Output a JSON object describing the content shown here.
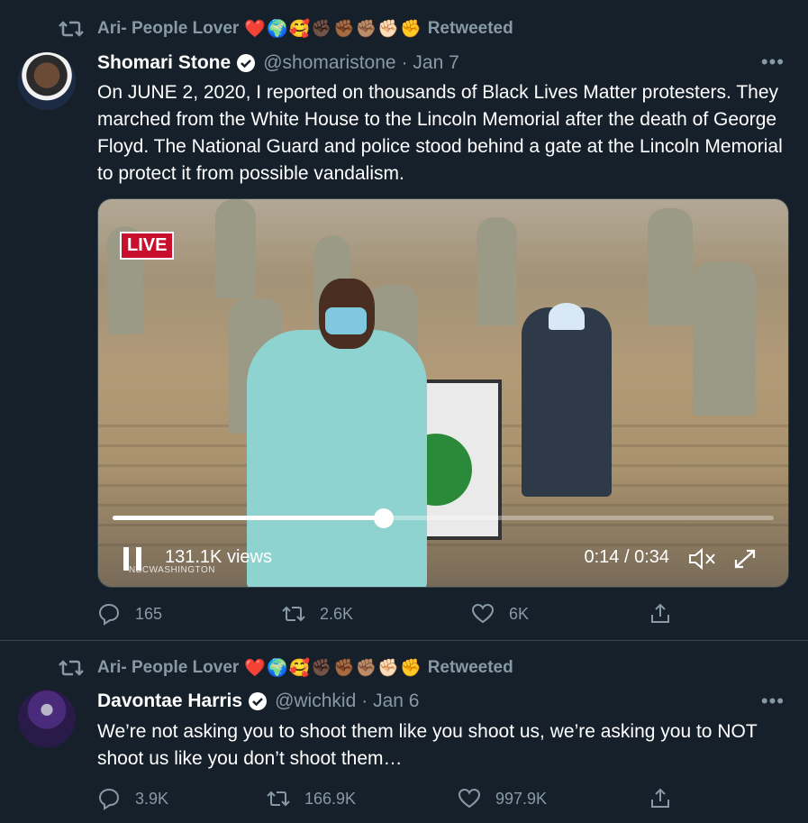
{
  "retweet_label": "Retweeted",
  "tweets": [
    {
      "retweeter": "Ari- People Lover",
      "retweeter_emojis": [
        "❤️",
        "🌍",
        "🥰",
        "✊🏿",
        "✊🏾",
        "✊🏽",
        "✊🏻",
        "✊"
      ],
      "name": "Shomari Stone",
      "handle": "@shomaristone",
      "date": "· Jan 7",
      "text": "On JUNE 2, 2020, I reported on thousands of Black Lives Matter protesters. They marched from the White House to the Lincoln Memorial after the death of George Floyd. The National Guard and police stood behind a gate at the Lincoln Memorial to protect it from possible vandalism.",
      "video": {
        "live_badge": "LIVE",
        "views": "131.1K views",
        "time": "0:14 / 0:34",
        "progress": 0.41,
        "watermark": "NBCWASHINGTON"
      },
      "replies": "165",
      "retweets": "2.6K",
      "likes": "6K"
    },
    {
      "retweeter": "Ari- People Lover",
      "retweeter_emojis": [
        "❤️",
        "🌍",
        "🥰",
        "✊🏿",
        "✊🏾",
        "✊🏽",
        "✊🏻",
        "✊"
      ],
      "name": "Davontae Harris",
      "handle": "@wichkid",
      "date": "· Jan 6",
      "text": "We’re not asking you to shoot them like you shoot us, we’re asking you to NOT shoot us like you don’t shoot them…",
      "replies": "3.9K",
      "retweets": "166.9K",
      "likes": "997.9K"
    }
  ],
  "colors": {
    "background": "#15202b",
    "muted": "#8899a6",
    "divider": "#38444d",
    "text": "#ffffff"
  }
}
